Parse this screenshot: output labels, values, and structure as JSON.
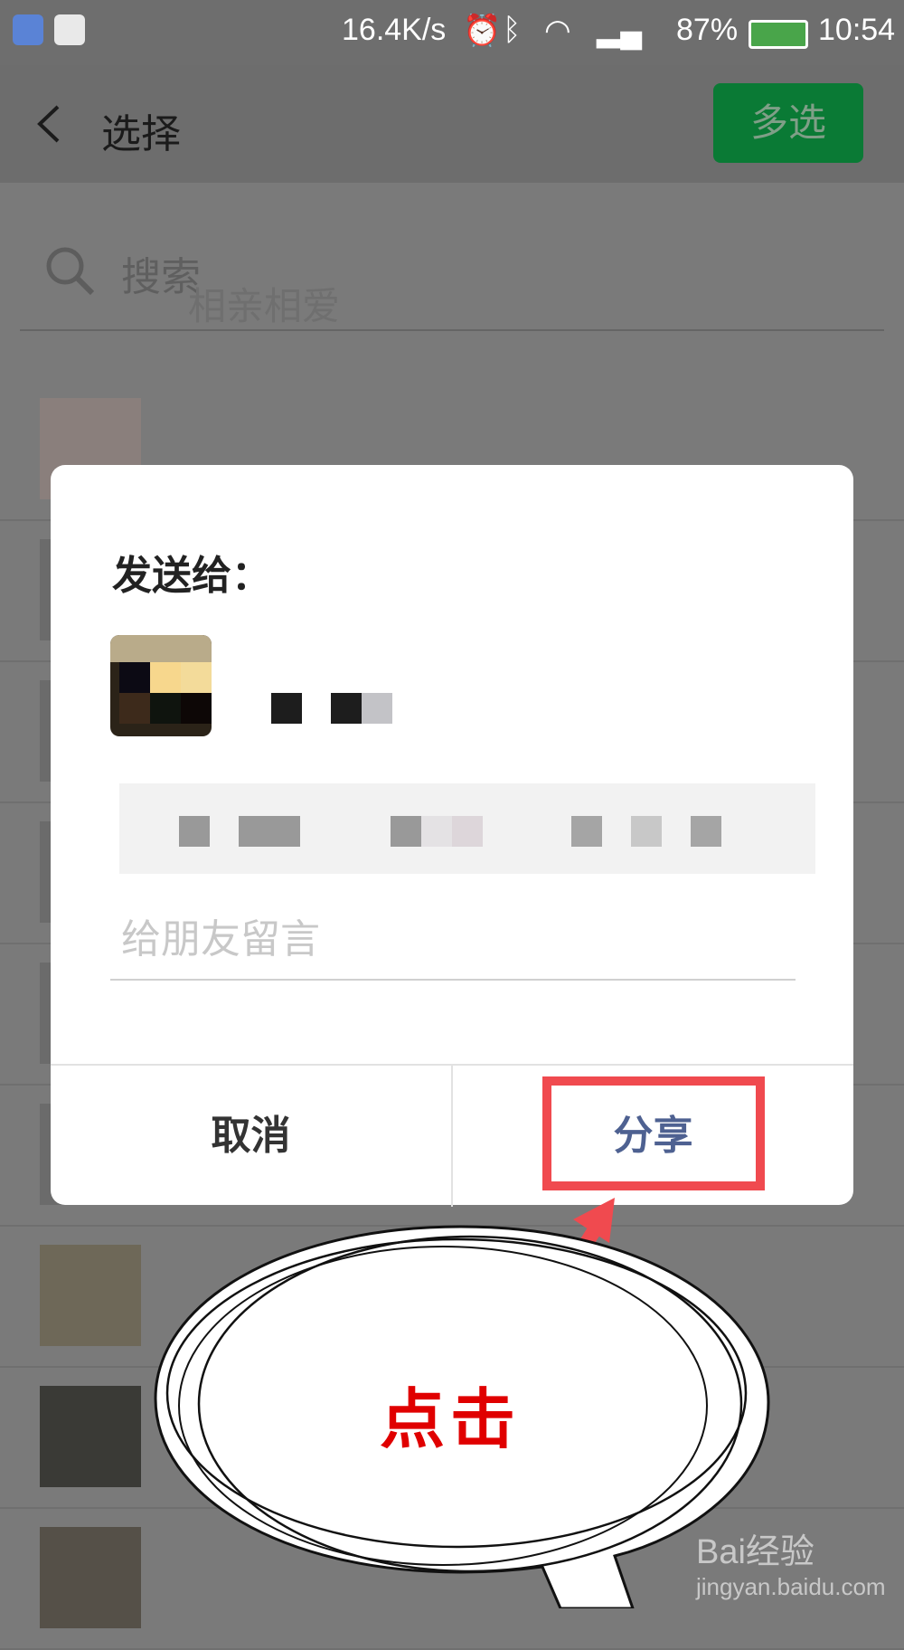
{
  "status_bar": {
    "speed": "16.4K/s",
    "battery_percent": "87%",
    "time": "10:54",
    "icons": [
      "shield-icon",
      "qq-icon",
      "alarm-icon",
      "bluetooth-icon",
      "wifi-icon",
      "signal-icon",
      "battery-icon"
    ]
  },
  "header": {
    "title": "选择",
    "multi_select": "多选"
  },
  "search": {
    "placeholder": "搜索"
  },
  "background_group": "相亲相爱",
  "dialog": {
    "send_to": "发送给：",
    "message_placeholder": "给朋友留言",
    "cancel": "取消",
    "share": "分享"
  },
  "annotation": {
    "text": "点击"
  },
  "watermark": {
    "brand": "Bai经验",
    "url": "jingyan.baidu.com"
  },
  "colors": {
    "accent_green": "#0a7a35",
    "annotation_red": "#f04a4f",
    "share_blue": "#4e6191"
  }
}
